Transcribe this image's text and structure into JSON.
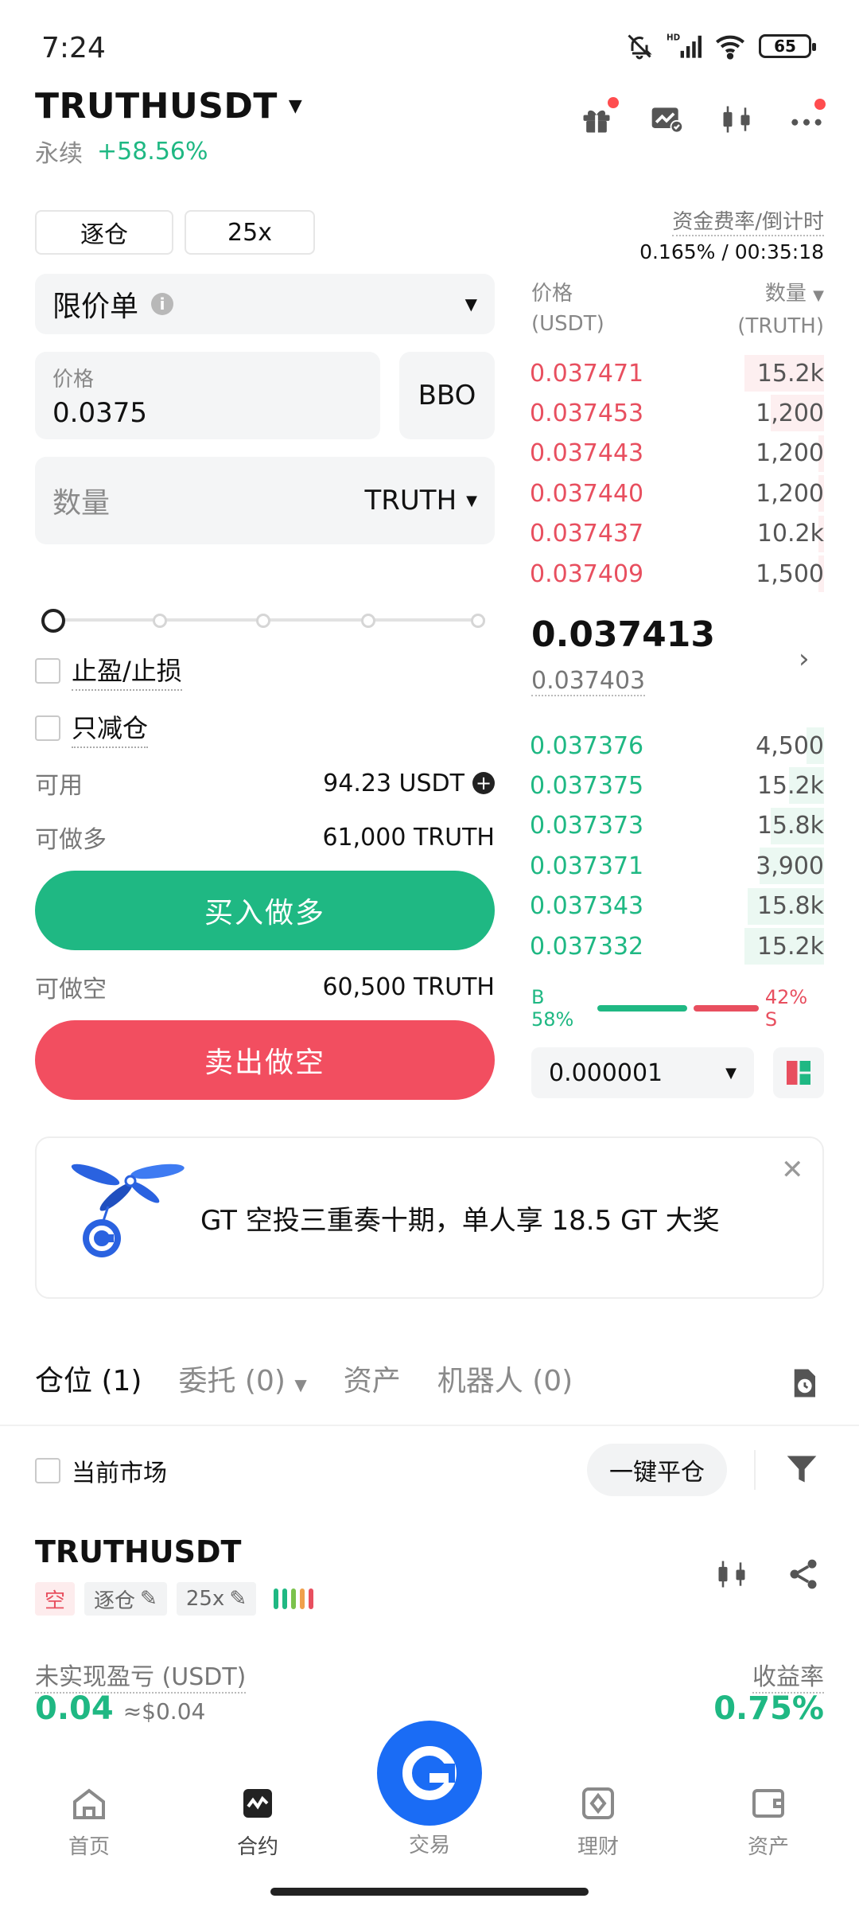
{
  "status_bar": {
    "time": "7:24",
    "battery": "65",
    "network": "HD"
  },
  "header": {
    "symbol": "TRUTHUSDT",
    "contract_type": "永续",
    "change": "+58.56%"
  },
  "margin_mode": "逐仓",
  "leverage": "25x",
  "funding": {
    "label": "资金费率/倒计时",
    "value": "0.165% / 00:35:18"
  },
  "order_form": {
    "order_type": "限价单",
    "price_label": "价格",
    "price_value": "0.0375",
    "bbo_label": "BBO",
    "qty_placeholder": "数量",
    "qty_unit": "TRUTH",
    "slider_level": 0,
    "tp_sl_label": "止盈/止损",
    "reduce_only_label": "只减仓",
    "available_label": "可用",
    "available_value": "94.23 USDT",
    "max_long_label": "可做多",
    "max_long_value": "61,000 TRUTH",
    "buy_label": "买入做多",
    "max_short_label": "可做空",
    "max_short_value": "60,500 TRUTH",
    "sell_label": "卖出做空"
  },
  "orderbook": {
    "price_header": "价格",
    "price_unit": "(USDT)",
    "qty_header": "数量",
    "qty_unit": "(TRUTH)",
    "asks": [
      {
        "price": "0.037471",
        "qty": "15.2k",
        "depth": 0.27
      },
      {
        "price": "0.037453",
        "qty": "1,200",
        "depth": 0.18
      },
      {
        "price": "0.037443",
        "qty": "1,200",
        "depth": 0.02
      },
      {
        "price": "0.037440",
        "qty": "1,200",
        "depth": 0.02
      },
      {
        "price": "0.037437",
        "qty": "10.2k",
        "depth": 0.02
      },
      {
        "price": "0.037409",
        "qty": "1,500",
        "depth": 0.02
      }
    ],
    "last_price": "0.037413",
    "mark_price": "0.037403",
    "bids": [
      {
        "price": "0.037376",
        "qty": "4,500",
        "depth": 0.06
      },
      {
        "price": "0.037375",
        "qty": "15.2k",
        "depth": 0.12
      },
      {
        "price": "0.037373",
        "qty": "15.8k",
        "depth": 0.18
      },
      {
        "price": "0.037371",
        "qty": "3,900",
        "depth": 0.22
      },
      {
        "price": "0.037343",
        "qty": "15.8k",
        "depth": 0.26
      },
      {
        "price": "0.037332",
        "qty": "15.2k",
        "depth": 0.27
      }
    ],
    "buy_ratio_label": "B 58%",
    "sell_ratio_label": "42% S",
    "buy_ratio": 0.58,
    "precision": "0.000001"
  },
  "banner": {
    "text": "GT 空投三重奏十期，单人享 18.5 GT 大奖",
    "close": "✕"
  },
  "tabs": {
    "positions": "仓位 (1)",
    "orders": "委托 (0)",
    "assets": "资产",
    "bots": "机器人 (0)"
  },
  "positions": {
    "current_market_label": "当前市场",
    "close_all_label": "一键平仓",
    "item": {
      "symbol": "TRUTHUSDT",
      "side": "空",
      "margin_mode": "逐仓",
      "leverage": "25x",
      "pnl_label": "未实现盈亏 (USDT)",
      "pnl_value": "0.04",
      "pnl_usd": "≈$0.04",
      "roe_label": "收益率",
      "roe_value": "0.75%"
    }
  },
  "bottom_nav": {
    "home": "首页",
    "futures": "合约",
    "trade": "交易",
    "earn": "理财",
    "assets": "资产"
  },
  "colors": {
    "green": "#1fb883",
    "red": "#e84f5f",
    "brand_blue": "#1a6cf5"
  }
}
